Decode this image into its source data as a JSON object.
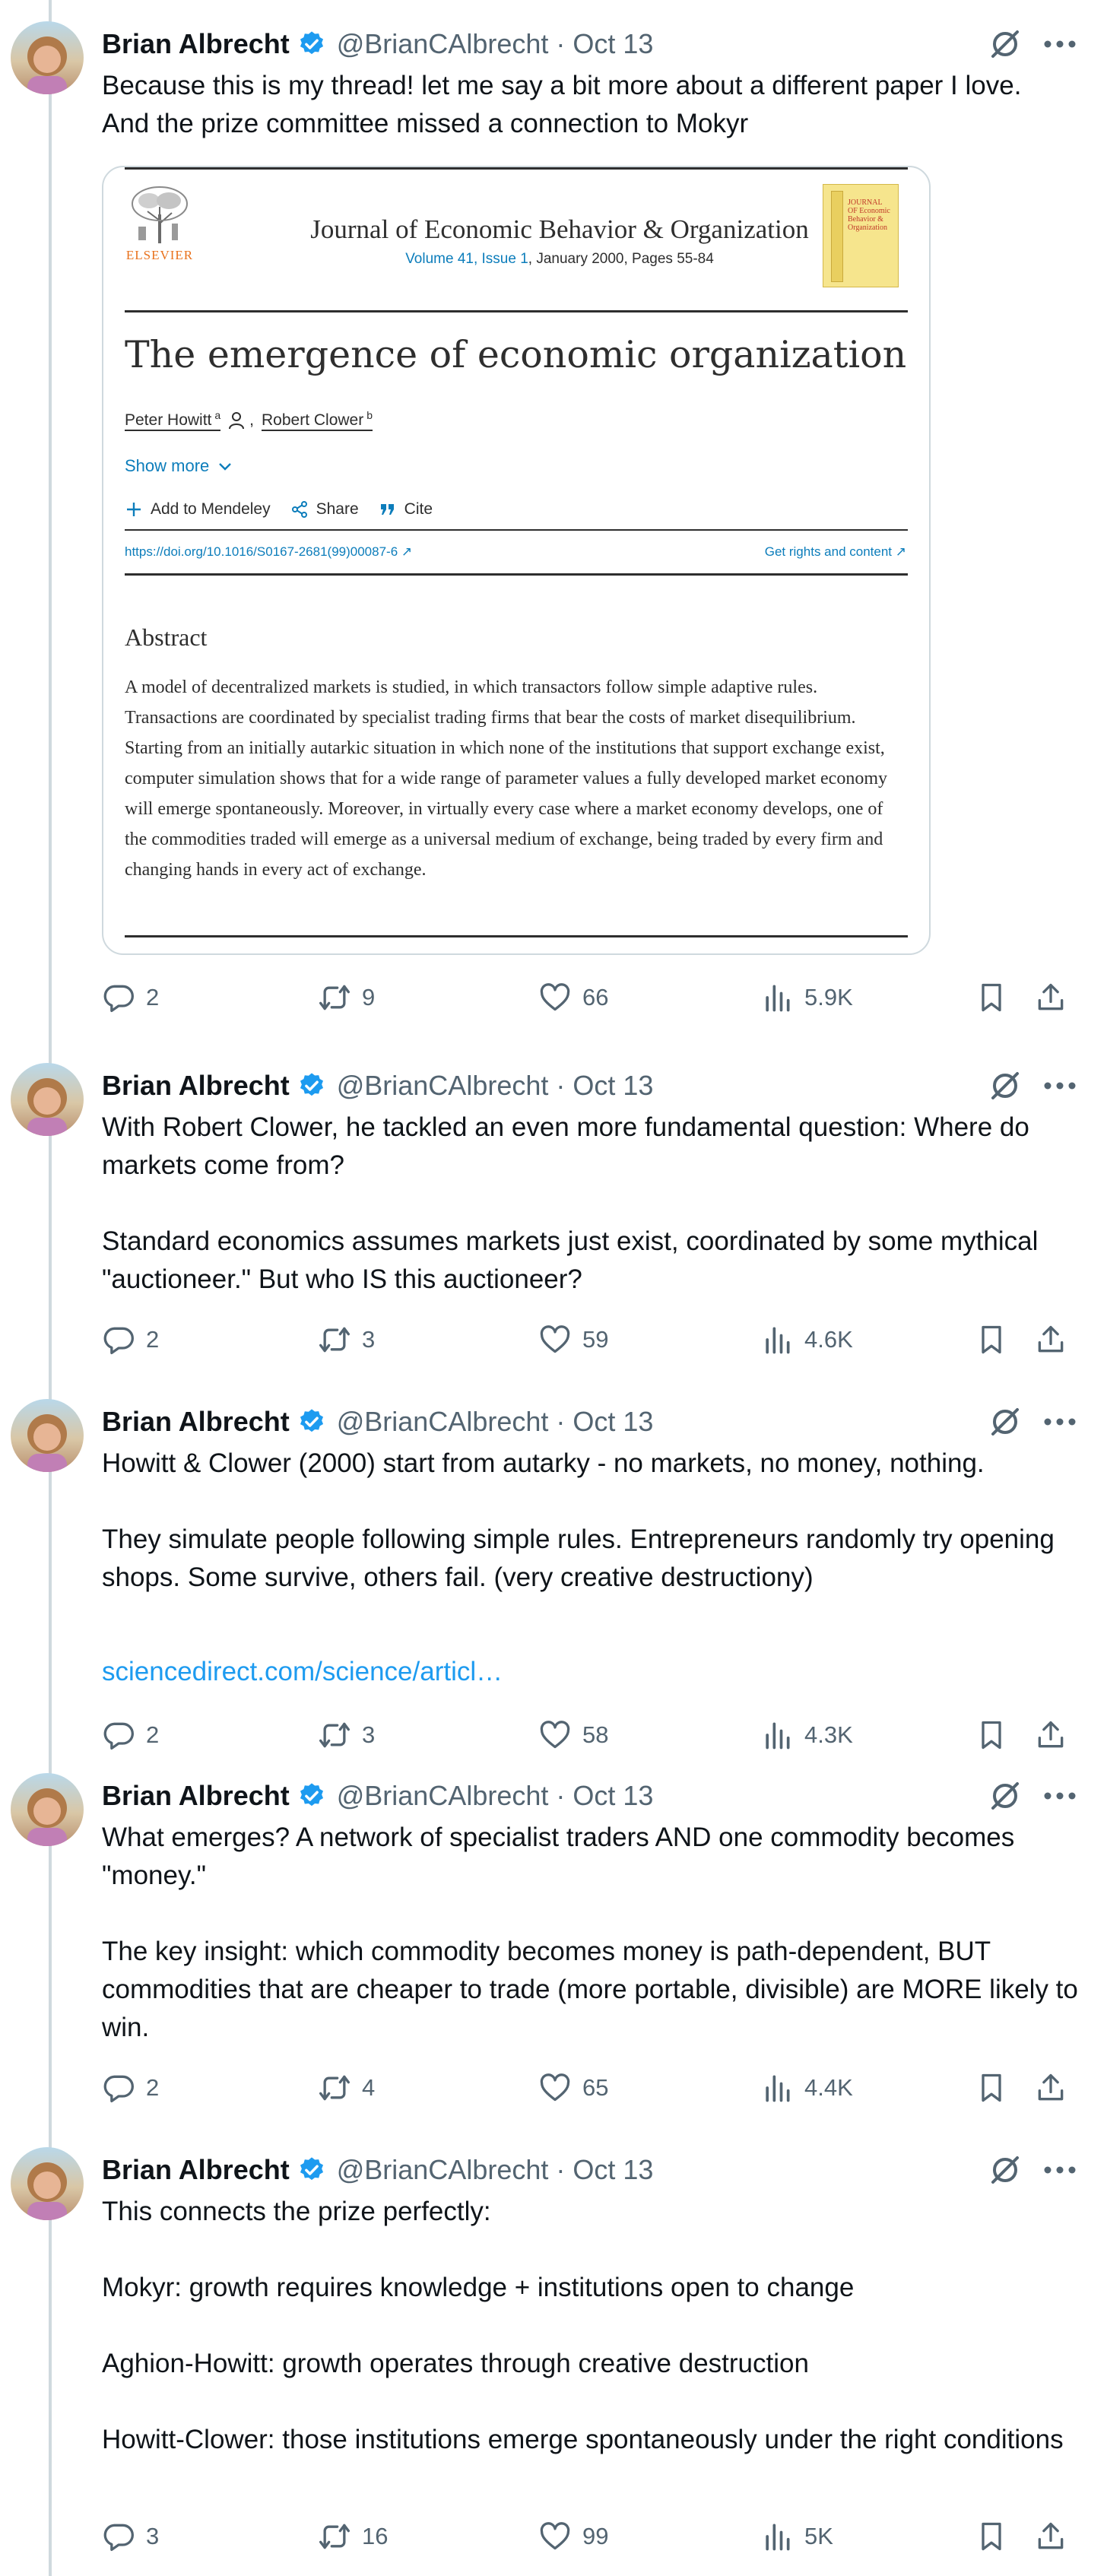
{
  "author": {
    "name": "Brian Albrecht",
    "handle": "@BrianCAlbrecht",
    "separator": "·"
  },
  "icons": {
    "verified": "verified-badge-icon",
    "grok": "grok-icon",
    "more": "more-icon",
    "reply": "reply-icon",
    "retweet": "retweet-icon",
    "like": "like-icon",
    "views": "views-icon",
    "bookmark": "bookmark-icon",
    "share": "share-icon"
  },
  "colors": {
    "link": "#1d9bf0",
    "verified": "#1d9bf0",
    "muted": "#536471",
    "elsevier_orange": "#e9711c",
    "sciencedirect_blue": "#0c7dbb"
  },
  "tweets": [
    {
      "date": "Oct 13",
      "text": "Because this is my thread! let me say a bit more about a different paper I love.\nAnd the prize committee missed a connection to Mokyr",
      "replies": "2",
      "retweets": "9",
      "likes": "66",
      "views": "5.9K"
    },
    {
      "date": "Oct 13",
      "text": "With Robert Clower, he tackled an even more fundamental question: Where do markets come from?\n\nStandard economics assumes markets just exist, coordinated by some mythical \"auctioneer.\" But who IS this auctioneer?",
      "replies": "2",
      "retweets": "3",
      "likes": "59",
      "views": "4.6K"
    },
    {
      "date": "Oct 13",
      "text": "Howitt & Clower (2000) start from autarky - no markets, no money, nothing.\n\nThey simulate people following simple rules. Entrepreneurs randomly try opening shops. Some survive, others fail. (very creative destructiony)",
      "link": "sciencedirect.com/science/articl…",
      "replies": "2",
      "retweets": "3",
      "likes": "58",
      "views": "4.3K"
    },
    {
      "date": "Oct 13",
      "text": "What emerges? A network of specialist traders AND one commodity becomes \"money.\"\n\nThe key insight: which commodity becomes money is path-dependent, BUT commodities that are cheaper to trade (more portable, divisible) are MORE likely to win.",
      "replies": "2",
      "retweets": "4",
      "likes": "65",
      "views": "4.4K"
    },
    {
      "date": "Oct 13",
      "text": "This connects the prize perfectly:\n\nMokyr: growth requires knowledge + institutions open to change\n\nAghion-Howitt: growth operates through creative destruction\n\nHowitt-Clower: those institutions emerge spontaneously under the right conditions",
      "replies": "3",
      "retweets": "16",
      "likes": "99",
      "views": "5K"
    }
  ],
  "paper": {
    "publisher": "ELSEVIER",
    "journal": "Journal of Economic Behavior & Organization",
    "volume_issue": "Volume 41, Issue 1",
    "date_pages": ", January 2000, Pages 55-84",
    "cover_text": "JOURNAL OF Economic Behavior & Organization",
    "title": "The emergence of economic organization",
    "author1": "Peter Howitt",
    "author1_sup": "a",
    "author2": "Robert Clower",
    "author2_sup": "b",
    "show_more": "Show more",
    "add_mendeley": "Add to Mendeley",
    "share": "Share",
    "cite": "Cite",
    "doi": "https://doi.org/10.1016/S0167-2681(99)00087-6 ↗",
    "rights": "Get rights and content ↗",
    "abstract_heading": "Abstract",
    "abstract": "A model of decentralized markets is studied, in which transactors follow simple adaptive rules. Transactions are coordinated by specialist trading firms that bear the costs of market disequilibrium. Starting from an initially autarkic situation in which none of the institutions that support exchange exist, computer simulation shows that for a wide range of parameter values a fully developed market economy will emerge spontaneously. Moreover, in virtually every case where a market economy develops, one of the commodities traded will emerge as a universal medium of exchange, being traded by every firm and changing hands in every act of exchange."
  }
}
